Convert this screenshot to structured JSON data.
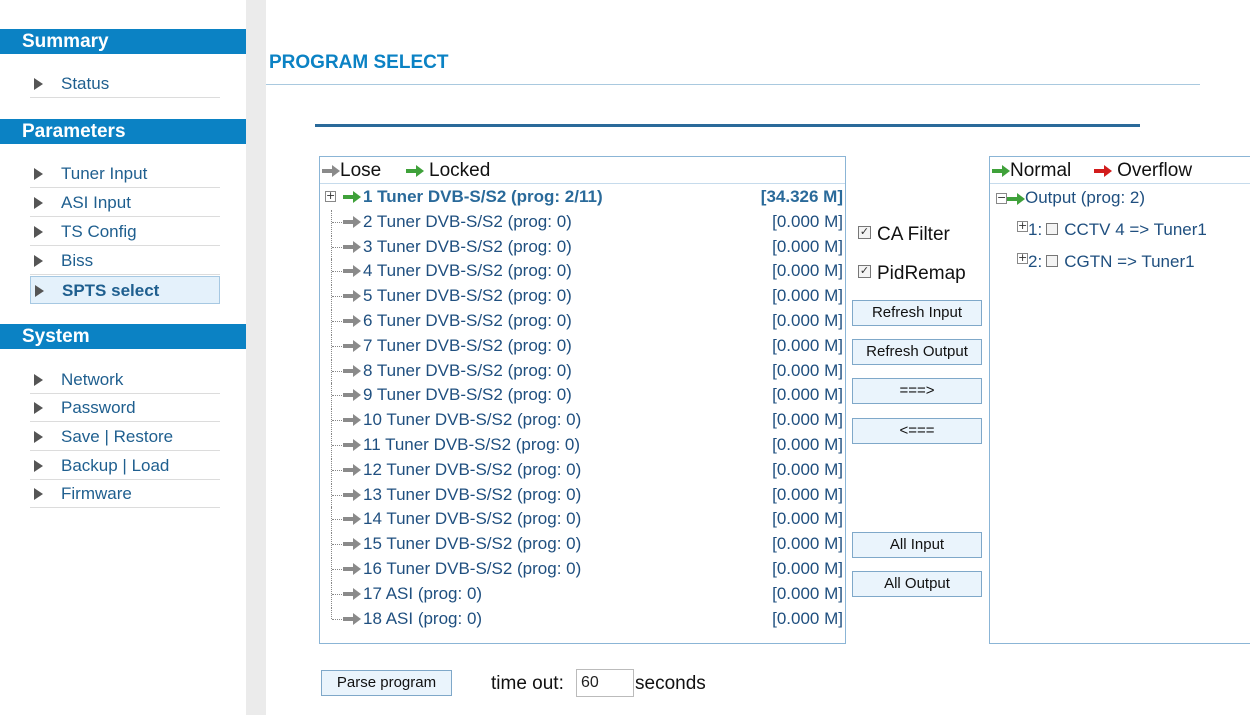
{
  "sidebar": {
    "sections": [
      {
        "title": "Summary",
        "items": [
          {
            "label": "Status"
          }
        ]
      },
      {
        "title": "Parameters",
        "items": [
          {
            "label": "Tuner Input"
          },
          {
            "label": "ASI Input"
          },
          {
            "label": "TS Config"
          },
          {
            "label": "Biss"
          },
          {
            "label": "SPTS select",
            "active": true
          }
        ]
      },
      {
        "title": "System",
        "items": [
          {
            "label": "Network"
          },
          {
            "label": "Password"
          },
          {
            "label": "Save | Restore"
          },
          {
            "label": "Backup | Load"
          },
          {
            "label": "Firmware"
          }
        ]
      }
    ]
  },
  "page": {
    "title": "PROGRAM SELECT"
  },
  "input_panel": {
    "legend": {
      "lose": "Lose",
      "locked": "Locked"
    },
    "rows": [
      {
        "name": "1 Tuner DVB-S/S2 (prog: 2/11)",
        "rate": "[34.326 M]",
        "locked": true
      },
      {
        "name": "2 Tuner DVB-S/S2 (prog: 0)",
        "rate": "[0.000 M]"
      },
      {
        "name": "3 Tuner DVB-S/S2 (prog: 0)",
        "rate": "[0.000 M]"
      },
      {
        "name": "4 Tuner DVB-S/S2 (prog: 0)",
        "rate": "[0.000 M]"
      },
      {
        "name": "5 Tuner DVB-S/S2 (prog: 0)",
        "rate": "[0.000 M]"
      },
      {
        "name": "6 Tuner DVB-S/S2 (prog: 0)",
        "rate": "[0.000 M]"
      },
      {
        "name": "7 Tuner DVB-S/S2 (prog: 0)",
        "rate": "[0.000 M]"
      },
      {
        "name": "8 Tuner DVB-S/S2 (prog: 0)",
        "rate": "[0.000 M]"
      },
      {
        "name": "9 Tuner DVB-S/S2 (prog: 0)",
        "rate": "[0.000 M]"
      },
      {
        "name": "10 Tuner DVB-S/S2 (prog: 0)",
        "rate": "[0.000 M]"
      },
      {
        "name": "11 Tuner DVB-S/S2 (prog: 0)",
        "rate": "[0.000 M]"
      },
      {
        "name": "12 Tuner DVB-S/S2 (prog: 0)",
        "rate": "[0.000 M]"
      },
      {
        "name": "13 Tuner DVB-S/S2 (prog: 0)",
        "rate": "[0.000 M]"
      },
      {
        "name": "14 Tuner DVB-S/S2 (prog: 0)",
        "rate": "[0.000 M]"
      },
      {
        "name": "15 Tuner DVB-S/S2 (prog: 0)",
        "rate": "[0.000 M]"
      },
      {
        "name": "16 Tuner DVB-S/S2 (prog: 0)",
        "rate": "[0.000 M]"
      },
      {
        "name": "17 ASI (prog: 0)",
        "rate": "[0.000 M]"
      },
      {
        "name": "18 ASI (prog: 0)",
        "rate": "[0.000 M]"
      }
    ]
  },
  "controls": {
    "ca_filter": {
      "label": "CA Filter",
      "checked": true
    },
    "pid_remap": {
      "label": "PidRemap",
      "checked": true
    },
    "refresh_input": "Refresh Input",
    "refresh_output": "Refresh Output",
    "move_right": "===>",
    "move_left": "<===",
    "all_input": "All Input",
    "all_output": "All Output"
  },
  "output_panel": {
    "legend": {
      "normal": "Normal",
      "overflow": "Overflow"
    },
    "root": "Output (prog: 2)",
    "items": [
      {
        "index": "1:",
        "label": "CCTV 4 => Tuner1"
      },
      {
        "index": "2:",
        "label": "CGTN => Tuner1"
      }
    ]
  },
  "footer": {
    "parse_button": "Parse program",
    "timeout_label": "time out:",
    "timeout_value": "60",
    "timeout_unit": "seconds"
  }
}
